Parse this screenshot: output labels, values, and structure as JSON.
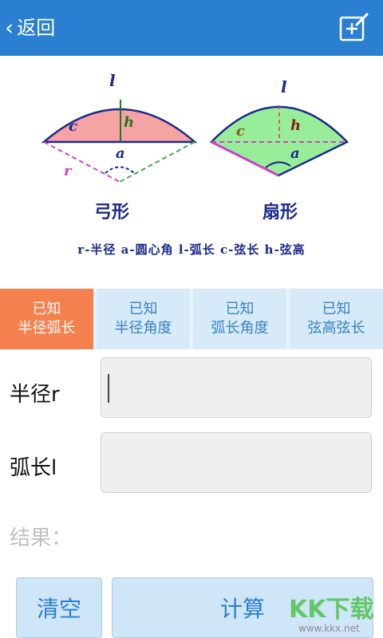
{
  "header": {
    "back_label": "返回"
  },
  "figure": {
    "left_title": "弓形",
    "right_title": "扇形",
    "letters": {
      "l": "l",
      "c": "c",
      "h": "h",
      "a": "a",
      "r": "r"
    },
    "legend": "r-半径  a-圆心角  l-弧长  c-弦长  h-弦高"
  },
  "tabs": [
    {
      "line1": "已知",
      "line2": "半径弧长",
      "active": true
    },
    {
      "line1": "已知",
      "line2": "半径角度",
      "active": false
    },
    {
      "line1": "已知",
      "line2": "弧长角度",
      "active": false
    },
    {
      "line1": "已知",
      "line2": "弦高弦长",
      "active": false
    }
  ],
  "form": {
    "radius_label": "半径r",
    "radius_value": "",
    "arc_label": "弧长l",
    "arc_value": ""
  },
  "result_label": "结果：",
  "buttons": {
    "clear": "清空",
    "calc": "计算"
  },
  "watermark": {
    "text": "KK下载",
    "url": "www.kkx.net"
  },
  "colors": {
    "header": "#2a7fd0",
    "active_tab": "#f4814e",
    "tab": "#d6eaf8"
  }
}
